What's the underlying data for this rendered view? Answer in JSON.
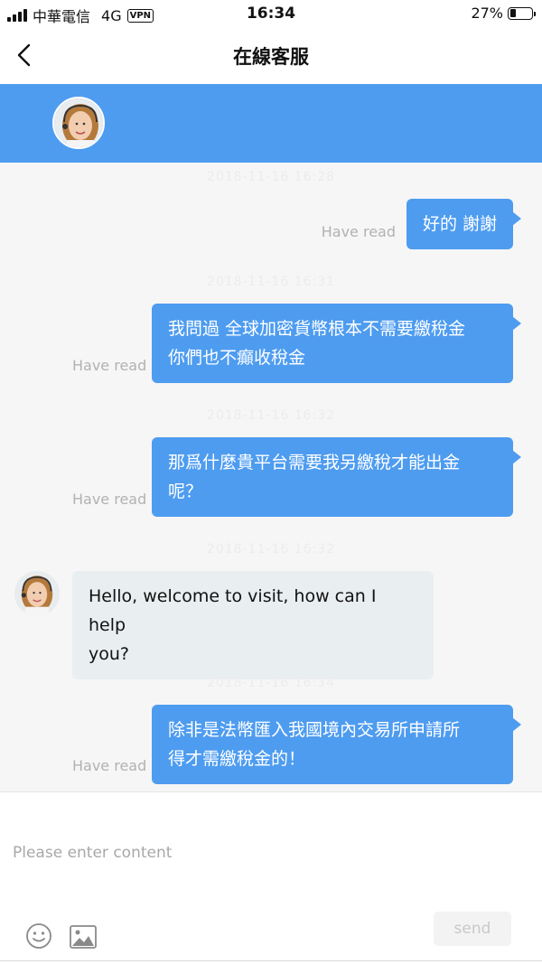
{
  "status_bar": {
    "carrier": "中華電信",
    "network": "4G",
    "vpn": "VPN",
    "time": "16:34",
    "battery_percent": "27%",
    "battery_level": 0.27
  },
  "nav": {
    "title": "在線客服",
    "back_icon": "chevron-left-icon"
  },
  "colors": {
    "accent": "#4e9cf0",
    "incoming_bubble": "#e9eef0",
    "read_label": "#b2b2b2"
  },
  "messages": [
    {
      "direction": "out",
      "timestamp": "2018-11-16 16:28",
      "lines": [
        "好的 謝謝"
      ],
      "status": "Have read"
    },
    {
      "direction": "out",
      "timestamp": "2018-11-16 16:31",
      "lines": [
        "我問過 全球加密貨幣根本不需要繳稅金",
        "你們也不癲收稅金"
      ],
      "status": "Have read"
    },
    {
      "direction": "out",
      "timestamp": "2018-11-16 16:32",
      "lines": [
        "那爲什麼貴平台需要我另繳稅才能出金",
        "呢？"
      ],
      "status": "Have read"
    },
    {
      "direction": "in",
      "timestamp": "2018-11-16 16:32",
      "lines": [
        "Hello, welcome to visit, how can I help",
        "you?"
      ]
    },
    {
      "direction": "out",
      "timestamp": "2018-11-16 16:34",
      "lines": [
        "除非是法幣匯入我國境內交易所申請所",
        "得才需繳稅金的！"
      ],
      "status": "Have read"
    }
  ],
  "composer": {
    "placeholder": "Please enter content",
    "send_label": "send",
    "emoji_icon": "emoji-icon",
    "image_icon": "image-icon"
  }
}
